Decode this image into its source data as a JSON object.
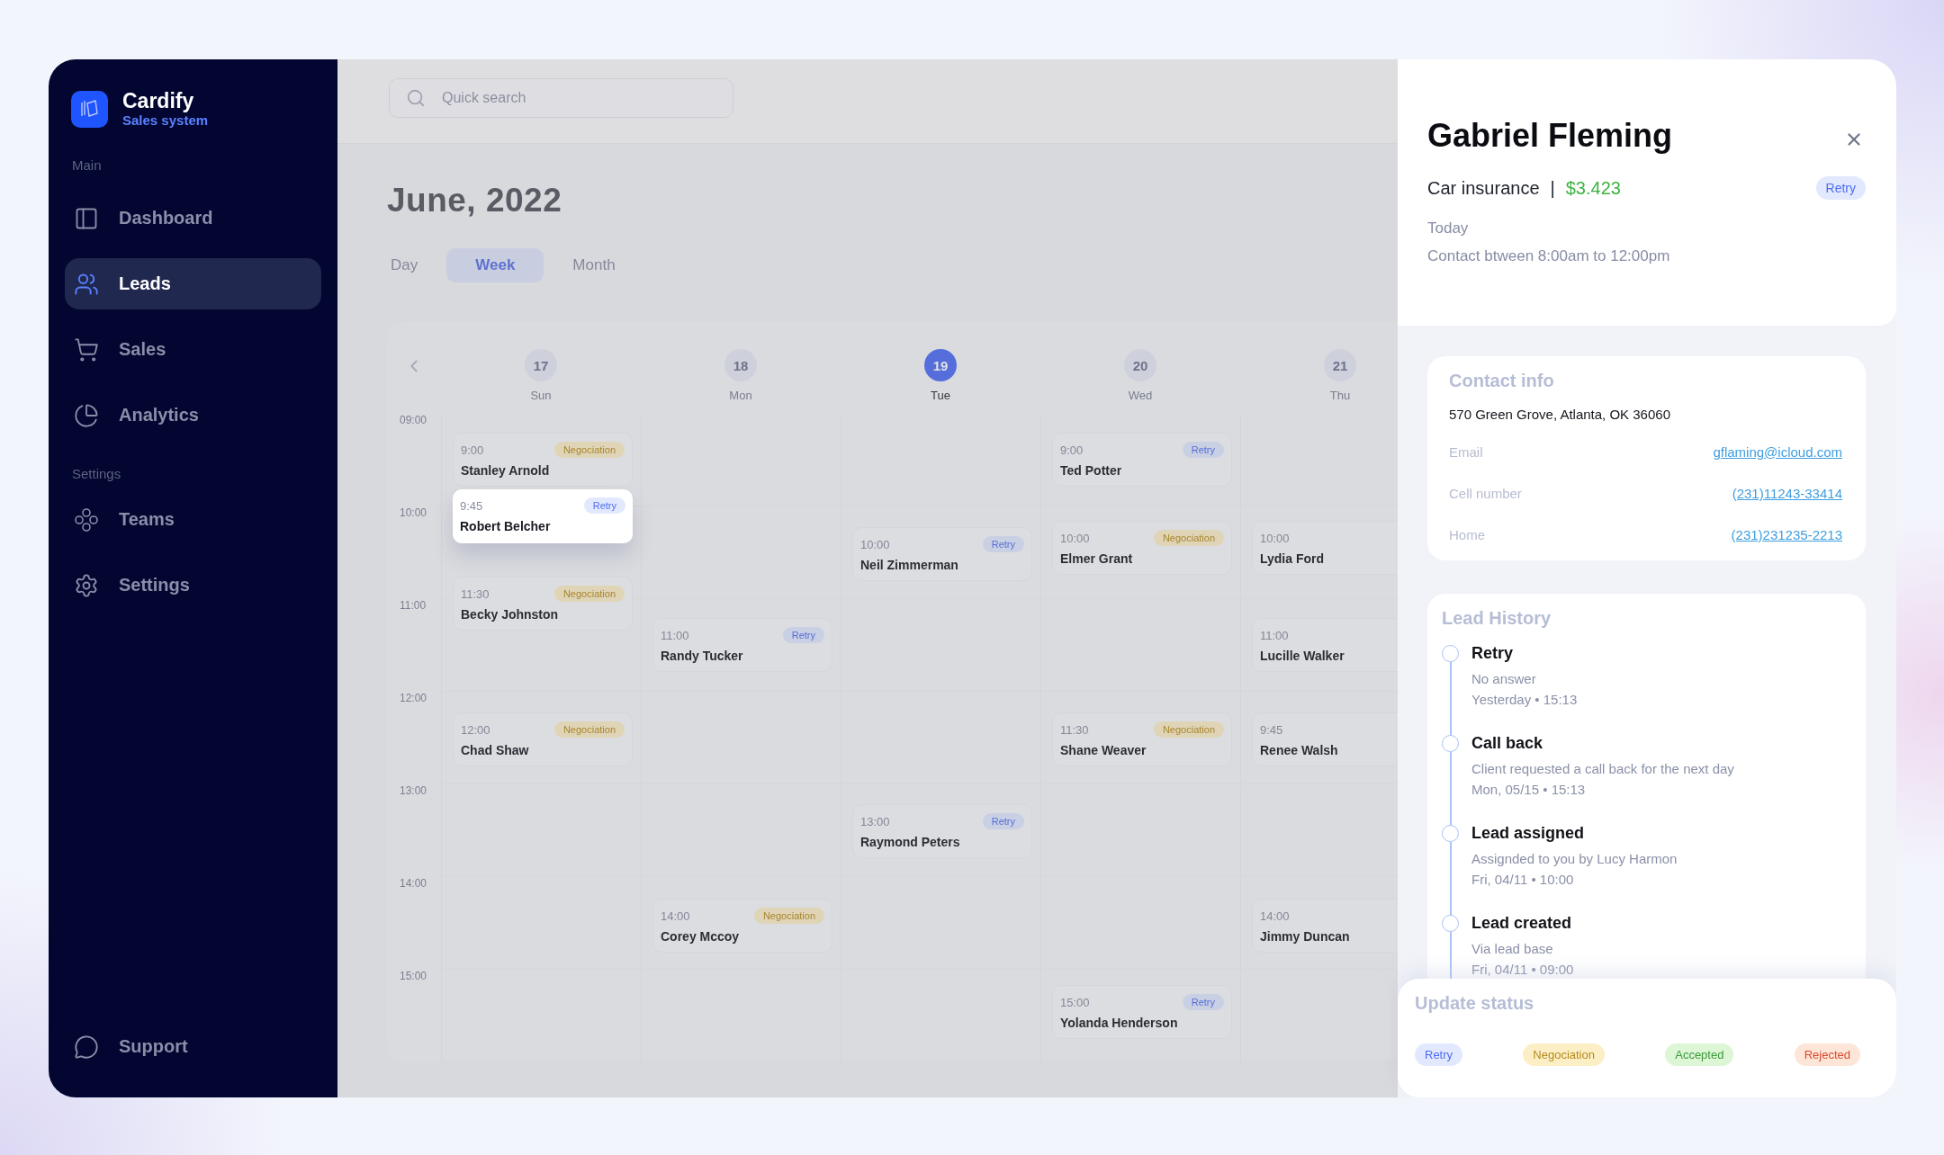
{
  "sidebar": {
    "brand": {
      "name": "Cardify",
      "tagline": "Sales system"
    },
    "sections": [
      {
        "heading": "Main",
        "items": [
          {
            "label": "Dashboard",
            "selected": false
          },
          {
            "label": "Leads",
            "selected": true
          },
          {
            "label": "Sales",
            "selected": false
          },
          {
            "label": "Analytics",
            "selected": false
          }
        ]
      },
      {
        "heading": "Settings",
        "items": [
          {
            "label": "Teams",
            "selected": false
          },
          {
            "label": "Settings",
            "selected": false
          }
        ]
      }
    ],
    "footer_item": {
      "label": "Support",
      "selected": false
    }
  },
  "search": {
    "placeholder": "Quick search"
  },
  "calendar": {
    "title": "June, 2022",
    "views": [
      {
        "label": "Day",
        "selected": false
      },
      {
        "label": "Week",
        "selected": true
      },
      {
        "label": "Month",
        "selected": false
      }
    ],
    "hours": [
      "09:00",
      "10:00",
      "11:00",
      "12:00",
      "13:00",
      "14:00",
      "15:00"
    ],
    "days": [
      {
        "date": "17",
        "weekday": "Sun",
        "selected": false,
        "events": [
          {
            "time": "9:00",
            "name": "Stanley Arnold",
            "badge": "Negociation",
            "kind": "negociation",
            "highlighted": false
          },
          {
            "time": "9:45",
            "name": "Robert Belcher",
            "badge": "Retry",
            "kind": "retry",
            "highlighted": true
          },
          {
            "time": "11:30",
            "name": "Becky Johnston",
            "badge": "Negociation",
            "kind": "negociation",
            "highlighted": false
          },
          {
            "time": "12:00",
            "name": "Chad Shaw",
            "badge": "Negociation",
            "kind": "negociation",
            "highlighted": false
          }
        ]
      },
      {
        "date": "18",
        "weekday": "Mon",
        "selected": false,
        "events": [
          {
            "time": "11:00",
            "name": "Randy Tucker",
            "badge": "Retry",
            "kind": "retry",
            "highlighted": false
          },
          {
            "time": "14:00",
            "name": "Corey Mccoy",
            "badge": "Negociation",
            "kind": "negociation",
            "highlighted": false
          }
        ]
      },
      {
        "date": "19",
        "weekday": "Tue",
        "selected": true,
        "events": [
          {
            "time": "10:00",
            "name": "Neil Zimmerman",
            "badge": "Retry",
            "kind": "retry",
            "highlighted": false
          },
          {
            "time": "13:00",
            "name": "Raymond Peters",
            "badge": "Retry",
            "kind": "retry",
            "highlighted": false
          }
        ]
      },
      {
        "date": "20",
        "weekday": "Wed",
        "selected": false,
        "events": [
          {
            "time": "9:00",
            "name": "Ted Potter",
            "badge": "Retry",
            "kind": "retry",
            "highlighted": false
          },
          {
            "time": "10:00",
            "name": "Elmer Grant",
            "badge": "Negociation",
            "kind": "negociation",
            "highlighted": false
          },
          {
            "time": "11:30",
            "name": "Shane Weaver",
            "badge": "Negociation",
            "kind": "negociation",
            "highlighted": false
          },
          {
            "time": "15:00",
            "name": "Yolanda Henderson",
            "badge": "Retry",
            "kind": "retry",
            "highlighted": false
          }
        ]
      },
      {
        "date": "21",
        "weekday": "Thu",
        "selected": false,
        "events": [
          {
            "time": "10:00",
            "name": "Lydia Ford",
            "highlighted": false
          },
          {
            "time": "11:00",
            "name": "Lucille Walker",
            "highlighted": false
          },
          {
            "time": "9:45",
            "name": "Renee Walsh",
            "highlighted": false
          },
          {
            "time": "14:00",
            "name": "Jimmy Duncan",
            "highlighted": false
          }
        ]
      }
    ]
  },
  "lead": {
    "name": "Gabriel Fleming",
    "product": "Car insurance",
    "separator": "|",
    "amount": "$3.423",
    "badge": {
      "label": "Retry",
      "kind": "retry"
    },
    "day": "Today",
    "window": "Contact btween 8:00am to 12:00pm"
  },
  "contact": {
    "title": "Contact info",
    "address": "570 Green Grove, Atlanta, OK 36060",
    "rows": [
      {
        "label": "Email",
        "value": "gflaming@icloud.com"
      },
      {
        "label": "Cell number",
        "value": "(231)11243-33414"
      },
      {
        "label": "Home",
        "value": "(231)231235-2213"
      }
    ]
  },
  "history": {
    "title": "Lead History",
    "entries": [
      {
        "title": "Retry",
        "detail": "No answer",
        "when": "Yesterday • 15:13"
      },
      {
        "title": "Call back",
        "detail": "Client requested a call back for the next day",
        "when": "Mon, 05/15 • 15:13"
      },
      {
        "title": "Lead assigned",
        "detail": "Assignded to you by Lucy Harmon",
        "when": "Fri, 04/11 • 10:00"
      },
      {
        "title": "Lead created",
        "detail": "Via lead base",
        "when": "Fri, 04/11 • 09:00"
      }
    ]
  },
  "update_status": {
    "title": "Update status",
    "options": [
      {
        "label": "Retry",
        "kind": "retry"
      },
      {
        "label": "Negociation",
        "kind": "negociation"
      },
      {
        "label": "Accepted",
        "kind": "accepted"
      },
      {
        "label": "Rejected",
        "kind": "rejected"
      }
    ]
  }
}
